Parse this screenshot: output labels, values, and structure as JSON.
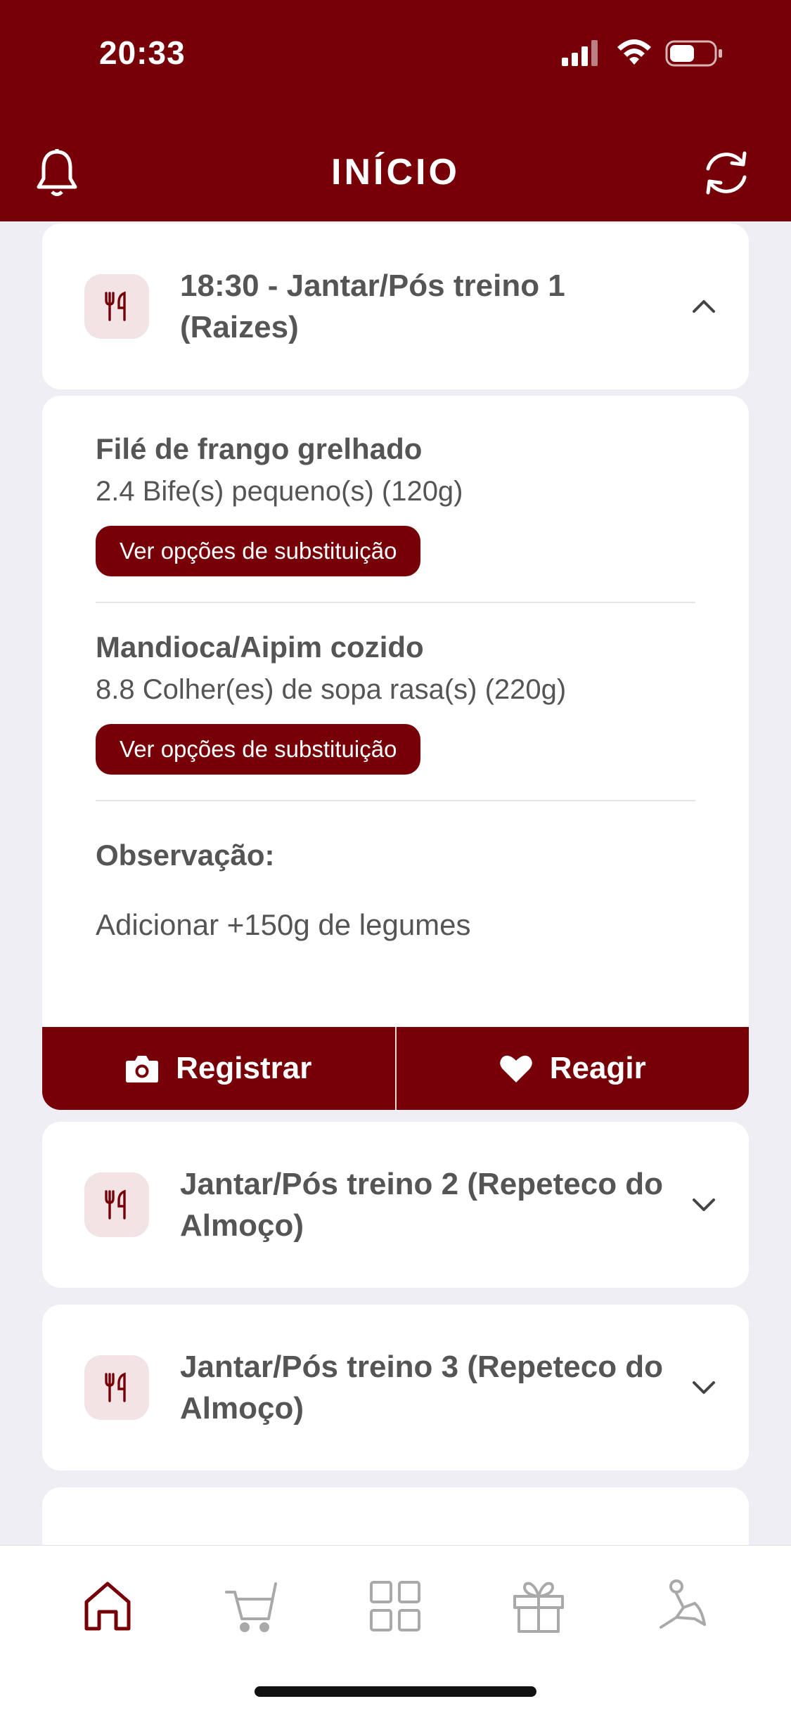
{
  "status_bar": {
    "time": "20:33"
  },
  "header": {
    "title": "INÍCIO",
    "left_icon": "bell-icon",
    "right_icon": "refresh-icon"
  },
  "meals": [
    {
      "title": "18:30 - Jantar/Pós treino 1 (Raizes)",
      "expanded": true,
      "icon": "utensils-icon"
    },
    {
      "title": "Jantar/Pós treino 2 (Repeteco do Almoço)",
      "expanded": false,
      "icon": "utensils-icon"
    },
    {
      "title": "Jantar/Pós treino 3 (Repeteco do Almoço)",
      "expanded": false,
      "icon": "utensils-icon"
    }
  ],
  "expanded_meal": {
    "foods": [
      {
        "name": "Filé de frango grelhado",
        "quantity": "2.4 Bife(s) pequeno(s) (120g)",
        "button_label": "Ver opções de substituição"
      },
      {
        "name": "Mandioca/Aipim cozido",
        "quantity": "8.8 Colher(es) de sopa rasa(s) (220g)",
        "button_label": "Ver opções de substituição"
      }
    ],
    "observation_label": "Observação:",
    "observation_text": "Adicionar +150g de legumes",
    "actions": {
      "register_label": "Registrar",
      "react_label": "Reagir"
    }
  },
  "tab_bar": {
    "items": [
      "home-icon",
      "cart-icon",
      "grid-icon",
      "gift-icon",
      "stretch-icon"
    ],
    "active_index": 0
  },
  "colors": {
    "brand": "#770008",
    "icon_bg": "#f2e3e4",
    "background": "#efeef4"
  }
}
